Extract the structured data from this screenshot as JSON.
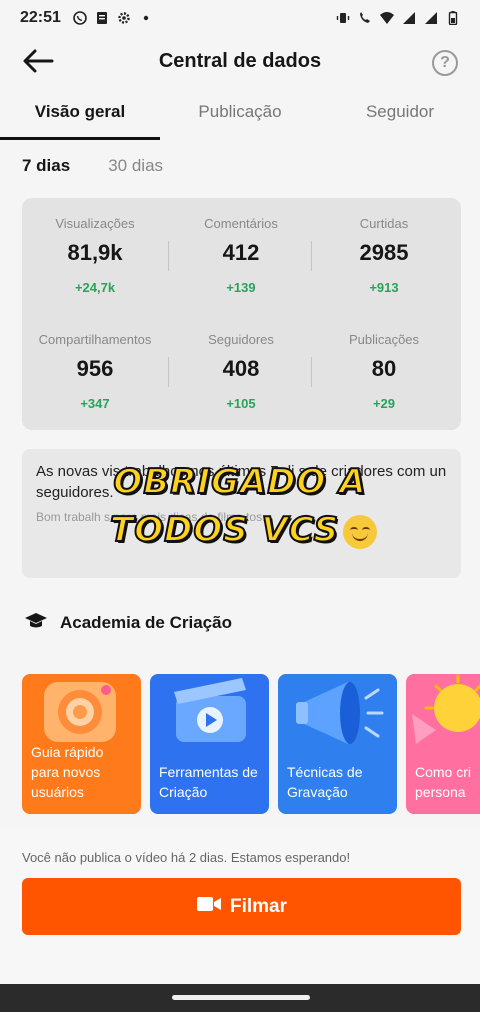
{
  "status_bar": {
    "time": "22:51",
    "left_icons": [
      "whatsapp-icon",
      "document-icon",
      "settings-icon",
      "dot-icon"
    ],
    "right_icons": [
      "vibrate-icon",
      "call-4g-icon",
      "wifi-icon",
      "signal-4g-icon",
      "signal-icon",
      "battery-icon"
    ]
  },
  "header": {
    "title": "Central de dados",
    "help_label": "?"
  },
  "tabs": [
    {
      "label": "Visão geral",
      "active": true
    },
    {
      "label": "Publicação",
      "active": false
    },
    {
      "label": "Seguidor",
      "active": false
    }
  ],
  "periods": [
    {
      "label": "7 dias",
      "active": true
    },
    {
      "label": "30 dias",
      "active": false
    }
  ],
  "stats": [
    {
      "label": "Visualizações",
      "value": "81,9k",
      "delta": "+24,7k"
    },
    {
      "label": "Comentários",
      "value": "412",
      "delta": "+139"
    },
    {
      "label": "Curtidas",
      "value": "2985",
      "delta": "+913"
    },
    {
      "label": "Compartilhamentos",
      "value": "956",
      "delta": "+347"
    },
    {
      "label": "Seguidores",
      "value": "408",
      "delta": "+105"
    },
    {
      "label": "Publicações",
      "value": "80",
      "delta": "+29"
    }
  ],
  "notice": {
    "main_text": "As novas vis                      trabalhos nos últimos 7 di                        s de criadores com un                             seguidores.",
    "sub_text": "Bom trabalh                                      s para mais dicas de filme                          tos."
  },
  "overlay": {
    "line1": "OBRIGADO A",
    "line2": "TODOS VCS"
  },
  "academy": {
    "title": "Academia de Criação",
    "courses": [
      {
        "label": "Guia rápido para novos usuários",
        "color": "#ff7a1a"
      },
      {
        "label": "Ferramentas de Criação",
        "color": "#2e72f0"
      },
      {
        "label": "Técnicas de Gravação",
        "color": "#2f80ee"
      },
      {
        "label": "Como cri persona",
        "color": "#ff6fa0"
      }
    ]
  },
  "bottom": {
    "message": "Você não publica o vídeo há 2 dias. Estamos esperando!",
    "film_button": "Filmar",
    "accent": "#ff5400"
  }
}
